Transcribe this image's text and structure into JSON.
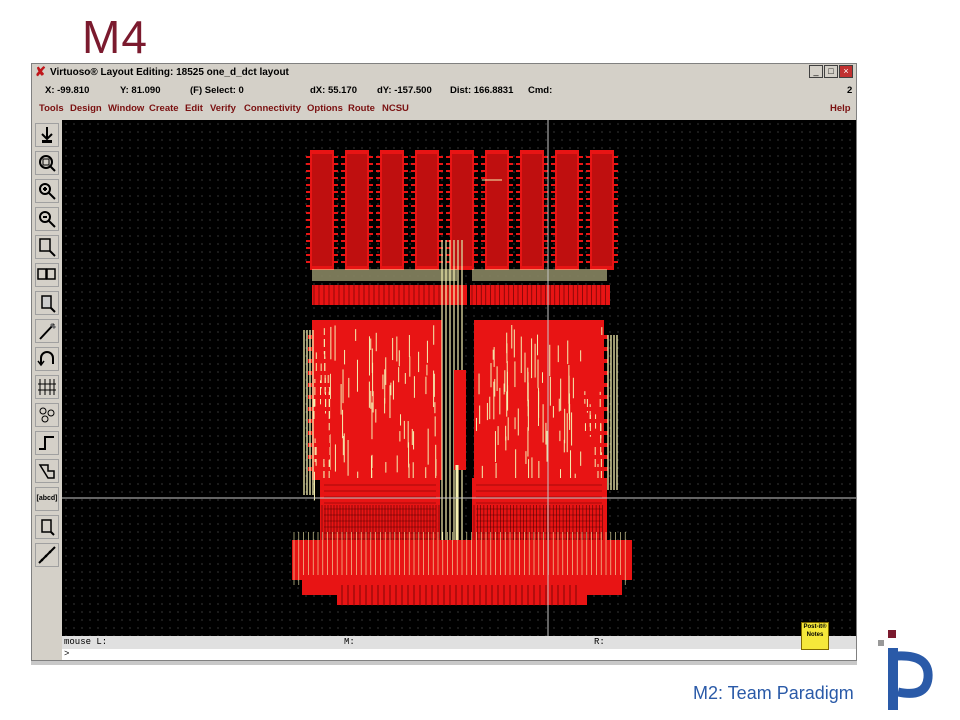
{
  "slide": {
    "title": "M4",
    "footer": "M2: Team Paradigm"
  },
  "window": {
    "title": "Virtuoso® Layout Editing: 18525 one_d_dct layout",
    "controls": {
      "minimize": "_",
      "maximize": "□",
      "close": "×"
    }
  },
  "status": {
    "x": "X: -99.810",
    "y": "Y: 81.090",
    "select": "(F) Select: 0",
    "dx": "dX: 55.170",
    "dy": "dY: -157.500",
    "dist": "Dist: 166.8831",
    "cmd": "Cmd:",
    "num": "2"
  },
  "menu": {
    "items": [
      "Tools",
      "Design",
      "Window",
      "Create",
      "Edit",
      "Verify",
      "Connectivity",
      "Options",
      "Route",
      "NCSU"
    ],
    "help": "Help"
  },
  "toolbar": {
    "tools": [
      "save-icon",
      "zoom-fit-icon",
      "zoom-in-icon",
      "zoom-out-icon",
      "stretch-icon",
      "copy-icon",
      "move-icon",
      "delete-icon",
      "undo-icon",
      "properties-icon",
      "hierarchy-icon",
      "path-icon",
      "polygon-icon",
      "label-icon",
      "rectangle-icon",
      "ruler-icon"
    ],
    "label_tool_text": "[abcd]"
  },
  "mousebar": {
    "left": "mouse L:",
    "middle": "M:",
    "right": "R:"
  },
  "cmdline": {
    "prompt": ">"
  },
  "postit": {
    "label": "Post-it® Notes"
  },
  "colors": {
    "layout_red": "#e81414",
    "metal_yellow": "#f5f0b0",
    "canvas": "#000000",
    "title": "#7b1a2e",
    "footer": "#2a5aa8"
  }
}
